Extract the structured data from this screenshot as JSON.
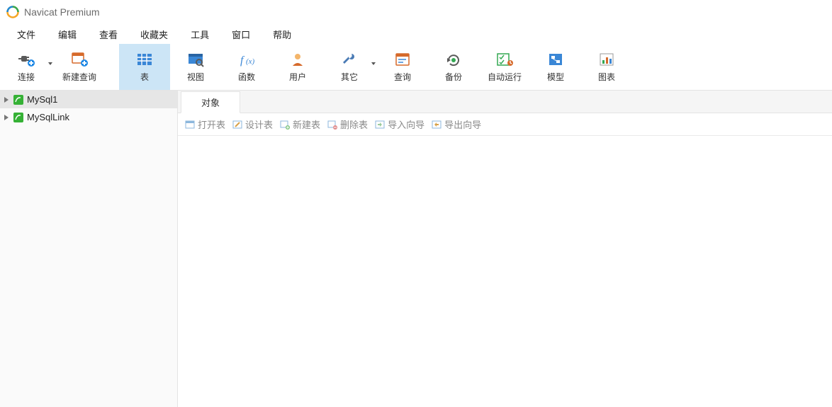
{
  "title": "Navicat Premium",
  "menus": [
    "文件",
    "编辑",
    "查看",
    "收藏夹",
    "工具",
    "窗口",
    "帮助"
  ],
  "toolbar": [
    {
      "label": "连接",
      "icon": "plug",
      "caret": true
    },
    {
      "label": "新建查询",
      "icon": "newquery"
    },
    {
      "label": "表",
      "icon": "table",
      "selected": true
    },
    {
      "label": "视图",
      "icon": "view"
    },
    {
      "label": "函数",
      "icon": "fx"
    },
    {
      "label": "用户",
      "icon": "user"
    },
    {
      "label": "其它",
      "icon": "wrench",
      "caret": true
    },
    {
      "label": "查询",
      "icon": "querywin"
    },
    {
      "label": "备份",
      "icon": "backup"
    },
    {
      "label": "自动运行",
      "icon": "autorun"
    },
    {
      "label": "模型",
      "icon": "model"
    },
    {
      "label": "图表",
      "icon": "chart"
    }
  ],
  "connections": [
    {
      "name": "MySql1",
      "selected": true
    },
    {
      "name": "MySqlLink",
      "selected": false
    }
  ],
  "active_tab": "对象",
  "object_toolbar": [
    "打开表",
    "设计表",
    "新建表",
    "删除表",
    "导入向导",
    "导出向导"
  ]
}
